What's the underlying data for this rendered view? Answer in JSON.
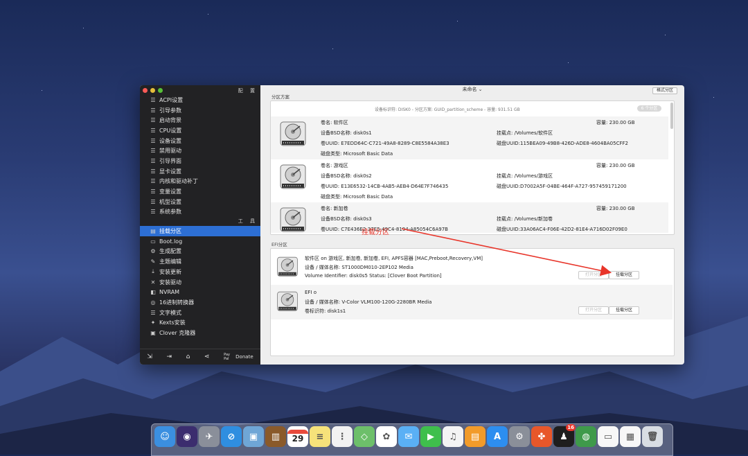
{
  "window": {
    "title": "未命名 ⌄",
    "top_right_button": "格式分区",
    "sidebar_header": "配 置",
    "tools_header": "工 具",
    "traffic_colors": [
      "#fc5b57",
      "#e5bf3c",
      "#57c038"
    ]
  },
  "sidebar": {
    "config_items": [
      {
        "icon": "list-icon",
        "label": "ACPI设置"
      },
      {
        "icon": "list-icon",
        "label": "引导参数"
      },
      {
        "icon": "list-icon",
        "label": "启动背景"
      },
      {
        "icon": "list-icon",
        "label": "CPU设置"
      },
      {
        "icon": "list-icon",
        "label": "设备设置"
      },
      {
        "icon": "list-icon",
        "label": "禁用驱动"
      },
      {
        "icon": "list-icon",
        "label": "引导界面"
      },
      {
        "icon": "list-icon",
        "label": "显卡设置"
      },
      {
        "icon": "list-icon",
        "label": "内核和驱动补丁"
      },
      {
        "icon": "list-icon",
        "label": "变量设置"
      },
      {
        "icon": "list-icon",
        "label": "机型设置"
      },
      {
        "icon": "list-icon",
        "label": "系统参数"
      }
    ],
    "tool_items": [
      {
        "icon": "disk-icon",
        "label": "挂载分区",
        "active": true
      },
      {
        "icon": "doc-icon",
        "label": "Boot.log"
      },
      {
        "icon": "gear-icon",
        "label": "生成配置"
      },
      {
        "icon": "brush-icon",
        "label": "主题编辑"
      },
      {
        "icon": "download-icon",
        "label": "安装更新"
      },
      {
        "icon": "wrench-icon",
        "label": "安装驱动"
      },
      {
        "icon": "chip-icon",
        "label": "NVRAM"
      },
      {
        "icon": "convert-icon",
        "label": "16进制转换器"
      },
      {
        "icon": "text-icon",
        "label": "文字模式"
      },
      {
        "icon": "kext-icon",
        "label": "Kexts安装"
      },
      {
        "icon": "clone-icon",
        "label": "Clover 克隆器"
      }
    ],
    "bottom": {
      "donate_label": "Donate",
      "paypal_label": "Pay Pal"
    }
  },
  "partitions": {
    "section_label": "分区方案",
    "device_info": "设备标识符: DISK0 - 分区方案: GUID_partition_scheme - 容量: 931.51 GB",
    "pill_label": "6 个分区",
    "volumes": [
      {
        "name": "卷名: 软件区",
        "capacity": "容量:  230.00 GB",
        "bsd": "设备BSD名称: disk0s1",
        "mount": "挂载点: /Volumes/软件区",
        "volume_uuid": "卷UUID: E7EDD64C-C721-49A8-8289-C8E5584A38E3",
        "disk_uuid": "磁盘UUID:115BEA09-49B8-426D-ADE8-4604BA05CFF2",
        "type": "磁盘类型: Microsoft Basic Data"
      },
      {
        "name": "卷名: 游戏区",
        "capacity": "容量:  230.00 GB",
        "bsd": "设备BSD名称: disk0s2",
        "mount": "挂载点: /Volumes/游戏区",
        "volume_uuid": "卷UUID: E13E6532-14CB-4AB5-AEB4-D64E7F746435",
        "disk_uuid": "磁盘UUID:D7002A5F-04BE-464F-A727-957459171200",
        "type": "磁盘类型: Microsoft Basic Data"
      },
      {
        "name": "卷名: 新加卷",
        "capacity": "容量:  230.00 GB",
        "bsd": "设备BSD名称: disk0s3",
        "mount": "挂载点: /Volumes/新加卷",
        "volume_uuid": "卷UUID: C7E436E2-37E5-49C4-8194-A85054C6A97B",
        "disk_uuid": "磁盘UUID:33A06AC4-F06E-42D2-81E4-A716D02F09E0",
        "type": ""
      }
    ]
  },
  "efi": {
    "section_label": "EFI分区",
    "items": [
      {
        "title": "软件区 on 游戏区, 新加卷, 新加卷, EFI, APFS容器 [MAC,Preboot,Recovery,VM]",
        "media": "设备 / 媒体名称: ST1000DM010-2EP102 Media",
        "identifier": "Volume Identifier: disk0s5 Status: [Clover Boot Partition]",
        "open_btn": "打开分区",
        "mount_btn": "挂载分区"
      },
      {
        "title": "EFI o",
        "media": "设备 / 媒体名称: V-Color VLM100-120G-2280BR Media",
        "identifier": "卷标识符: disk1s1",
        "open_btn": "打开分区",
        "mount_btn": "挂载分区"
      }
    ]
  },
  "annotation": {
    "text": "挂载分区",
    "color": "#e8352a"
  },
  "dock": {
    "calendar_day": "29",
    "qq_badge": "16",
    "icons": [
      "finder-icon",
      "siri-icon",
      "launchpad-icon",
      "safari-icon",
      "preview-icon",
      "notebook-icon",
      "calendar-icon",
      "notes-icon",
      "reminders-icon",
      "maps-icon",
      "photos-icon",
      "messages-icon",
      "facetime-icon",
      "music-icon",
      "books-icon",
      "appstore-icon",
      "settings-icon",
      "clover-icon",
      "qq-icon",
      "ball-icon",
      "document-icon",
      "screenshot-icon",
      "trash-icon"
    ]
  }
}
